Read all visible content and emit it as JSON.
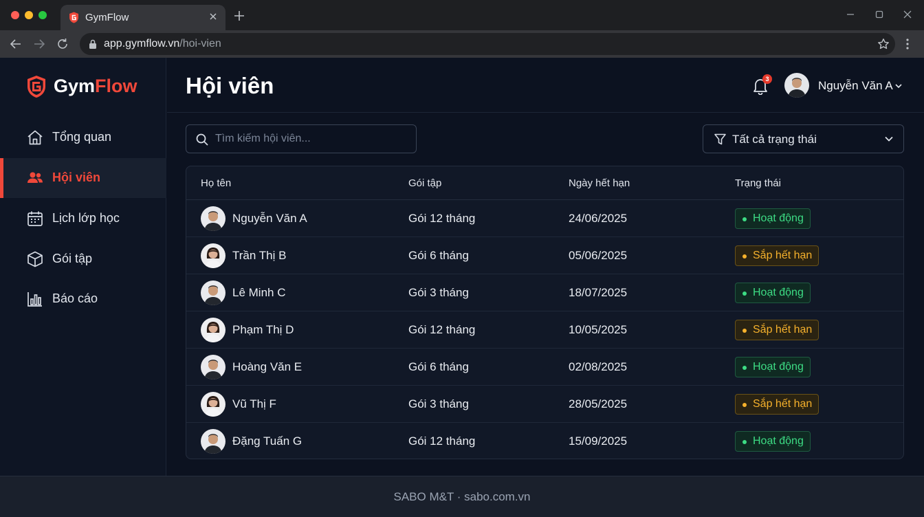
{
  "browser": {
    "tab_title": "GymFlow",
    "url_host": "app.gymflow.vn",
    "url_path": "/hoi-vien"
  },
  "brand": {
    "part1": "Gym",
    "part2": "Flow",
    "accent_color": "#f0483a"
  },
  "sidebar": {
    "items": [
      {
        "label": "Tổng quan",
        "icon": "home-icon",
        "active": false
      },
      {
        "label": "Hội viên",
        "icon": "users-icon",
        "active": true
      },
      {
        "label": "Lịch lớp học",
        "icon": "calendar-icon",
        "active": false
      },
      {
        "label": "Gói tập",
        "icon": "box-icon",
        "active": false
      },
      {
        "label": "Báo cáo",
        "icon": "bar-chart-icon",
        "active": false
      }
    ]
  },
  "header": {
    "title": "Hội viên",
    "notification_count": "3",
    "user_name": "Nguyễn Văn A"
  },
  "toolbar": {
    "search_placeholder": "Tìm kiếm hội viên...",
    "search_value": "",
    "status_filter": "Tất cả trạng thái"
  },
  "table": {
    "columns": [
      "Họ tên",
      "Gói tập",
      "Ngày hết hạn",
      "Trạng thái"
    ],
    "rows": [
      {
        "name": "Nguyễn Văn A",
        "plan": "Gói 12 tháng",
        "expiry": "24/06/2025",
        "status": "Hoạt động",
        "status_type": "active",
        "avatar": "male-avatar-icon"
      },
      {
        "name": "Trần Thị B",
        "plan": "Gói 6 tháng",
        "expiry": "05/06/2025",
        "status": "Sắp hết hạn",
        "status_type": "expiring",
        "avatar": "female-avatar-icon"
      },
      {
        "name": "Lê Minh C",
        "plan": "Gói 3 tháng",
        "expiry": "18/07/2025",
        "status": "Hoạt động",
        "status_type": "active",
        "avatar": "male-avatar-icon"
      },
      {
        "name": "Phạm Thị D",
        "plan": "Gói 12 tháng",
        "expiry": "10/05/2025",
        "status": "Sắp hết hạn",
        "status_type": "expiring",
        "avatar": "female-avatar-icon"
      },
      {
        "name": "Hoàng Văn E",
        "plan": "Gói 6 tháng",
        "expiry": "02/08/2025",
        "status": "Hoạt động",
        "status_type": "active",
        "avatar": "male-avatar-icon"
      },
      {
        "name": "Vũ Thị F",
        "plan": "Gói 3 tháng",
        "expiry": "28/05/2025",
        "status": "Sắp hết hạn",
        "status_type": "expiring",
        "avatar": "female-avatar-icon"
      },
      {
        "name": "Đặng Tuấn G",
        "plan": "Gói 12 tháng",
        "expiry": "15/09/2025",
        "status": "Hoạt động",
        "status_type": "active",
        "avatar": "male-avatar-icon"
      }
    ]
  },
  "footer": {
    "text": "SABO M&T · sabo.com.vn"
  },
  "colors": {
    "active_status": "#3ddc84",
    "expiring_status": "#f6b12c",
    "notification_badge": "#e5392b"
  }
}
